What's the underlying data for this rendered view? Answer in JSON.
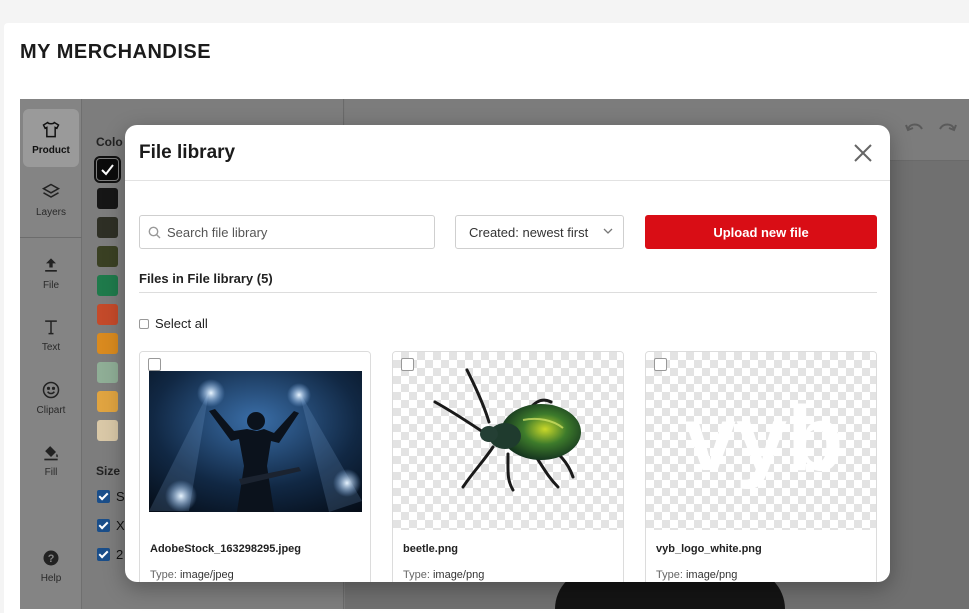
{
  "page": {
    "title": "MY MERCHANDISE"
  },
  "tool_rail": {
    "items": [
      {
        "label": "Product",
        "icon": "tshirt-icon"
      },
      {
        "label": "Layers",
        "icon": "layers-icon"
      },
      {
        "label": "File",
        "icon": "upload-icon"
      },
      {
        "label": "Text",
        "icon": "text-icon"
      },
      {
        "label": "Clipart",
        "icon": "smiley-icon"
      },
      {
        "label": "Fill",
        "icon": "paint-bucket-icon"
      },
      {
        "label": "Help",
        "icon": "help-icon"
      }
    ]
  },
  "options": {
    "color_label": "Colo",
    "size_label": "Size",
    "swatches": [
      "#0b0b0b",
      "#161616",
      "#2e2f25",
      "#3a4023",
      "#1f7a4b",
      "#c44a2a",
      "#d98a1f",
      "#8fae96",
      "#e0a441",
      "#d9c8a7"
    ],
    "sizes": [
      "S",
      "X",
      "2"
    ]
  },
  "modal": {
    "title": "File library",
    "search_placeholder": "Search file library",
    "sort_value": "Created: newest first",
    "upload_label": "Upload new file",
    "files_heading": "Files in File library (5)",
    "select_all_label": "Select all",
    "type_prefix": "Type:",
    "files": [
      {
        "name": "AdobeStock_163298295.jpeg",
        "type": "image/jpeg"
      },
      {
        "name": "beetle.png",
        "type": "image/png"
      },
      {
        "name": "vyb_logo_white.png",
        "type": "image/png"
      }
    ],
    "logo_text": "vyb"
  },
  "colors": {
    "accent": "#d90d15",
    "checkbox": "#1a4e8a"
  }
}
